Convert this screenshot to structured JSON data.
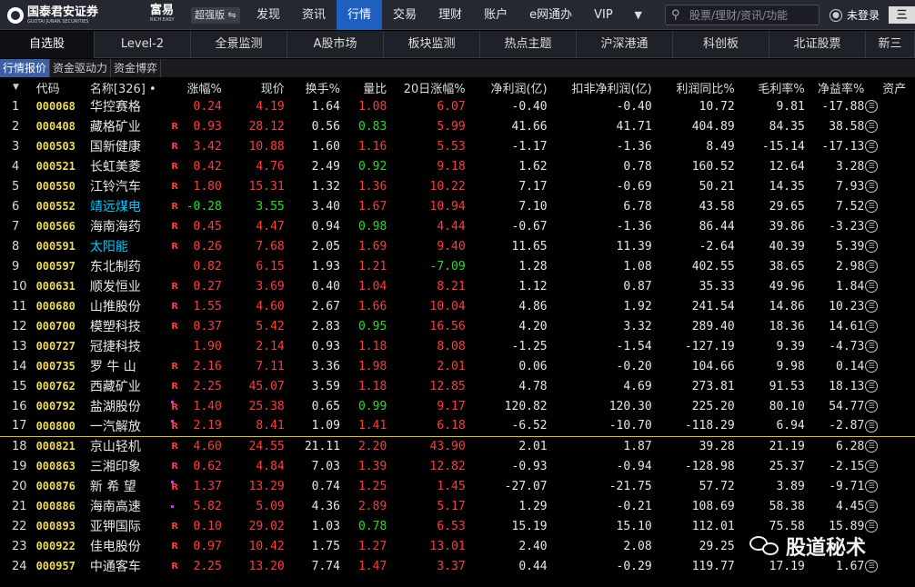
{
  "app": {
    "brand_name": "国泰君安证券",
    "brand_sub": "GUOTAI JUNAN SECURITIES",
    "product_name": "富易",
    "product_sub": "RICH EASY",
    "edition": "超强版 ⇋"
  },
  "topnav": [
    "发现",
    "资讯",
    "行情",
    "交易",
    "理财",
    "账户",
    "e网通办",
    "VIP"
  ],
  "topnav_active": 2,
  "search": {
    "placeholder": "股票/理财/资讯/功能"
  },
  "login_label": "未登录",
  "menu_label": "三",
  "tabs": [
    "自选股",
    "Level-2",
    "全景监测",
    "A股市场",
    "板块监测",
    "热点主题",
    "沪深港通",
    "科创板",
    "北证股票",
    "新三"
  ],
  "tabs_active": 0,
  "subtabs": [
    "行情报价",
    "资金驱动力",
    "资金博弈"
  ],
  "subtabs_active": 0,
  "columns": {
    "sort_icon": "▼",
    "code": "代码",
    "name": "名称[326]",
    "name_dot": "•",
    "chg": "涨幅%",
    "price": "现价",
    "turnover": "换手%",
    "vol_ratio": "量比",
    "chg20": "20日涨幅%",
    "net_profit": "净利润(亿)",
    "deducted_profit": "扣非净利润(亿)",
    "profit_yoy": "利润同比%",
    "gross_margin": "毛利率%",
    "roe": "净益率%",
    "assets": "资产"
  },
  "rows": [
    {
      "idx": "1",
      "code": "000068",
      "name": "华控赛格",
      "mark": "",
      "dot": false,
      "chg": "0.24",
      "price": "4.19",
      "turnover": "1.64",
      "vol_ratio": "1.08",
      "vol_ratio_color": "up",
      "chg20": "6.07",
      "chg20_color": "up",
      "net_profit": "-0.40",
      "deducted_profit": "-0.40",
      "profit_yoy": "10.72",
      "gross_margin": "9.81",
      "roe": "-17.88"
    },
    {
      "idx": "2",
      "code": "000408",
      "name": "藏格矿业",
      "mark": "R",
      "dot": false,
      "chg": "0.93",
      "price": "28.12",
      "turnover": "0.56",
      "vol_ratio": "0.83",
      "vol_ratio_color": "dn",
      "chg20": "5.99",
      "chg20_color": "up",
      "net_profit": "41.66",
      "deducted_profit": "41.71",
      "profit_yoy": "404.89",
      "gross_margin": "84.35",
      "roe": "38.58"
    },
    {
      "idx": "3",
      "code": "000503",
      "name": "国新健康",
      "mark": "R",
      "dot": false,
      "chg": "3.42",
      "price": "10.88",
      "turnover": "1.60",
      "vol_ratio": "1.16",
      "vol_ratio_color": "up",
      "chg20": "5.53",
      "chg20_color": "up",
      "net_profit": "-1.17",
      "deducted_profit": "-1.36",
      "profit_yoy": "8.49",
      "gross_margin": "-15.14",
      "roe": "-17.13"
    },
    {
      "idx": "4",
      "code": "000521",
      "name": "长虹美菱",
      "mark": "R",
      "dot": false,
      "chg": "0.42",
      "price": "4.76",
      "turnover": "2.49",
      "vol_ratio": "0.92",
      "vol_ratio_color": "dn",
      "chg20": "9.18",
      "chg20_color": "up",
      "net_profit": "1.62",
      "deducted_profit": "0.78",
      "profit_yoy": "160.52",
      "gross_margin": "12.64",
      "roe": "3.28"
    },
    {
      "idx": "5",
      "code": "000550",
      "name": "江铃汽车",
      "mark": "R",
      "dot": false,
      "chg": "1.80",
      "price": "15.31",
      "turnover": "1.32",
      "vol_ratio": "1.36",
      "vol_ratio_color": "up",
      "chg20": "10.22",
      "chg20_color": "up",
      "net_profit": "7.17",
      "deducted_profit": "-0.69",
      "profit_yoy": "50.21",
      "gross_margin": "14.35",
      "roe": "7.93"
    },
    {
      "idx": "6",
      "code": "000552",
      "name": "靖远煤电",
      "mark": "R",
      "dot": false,
      "name_hl": true,
      "chg": "-0.28",
      "chg_color": "dn",
      "price": "3.55",
      "price_color": "dn",
      "turnover": "3.40",
      "vol_ratio": "1.67",
      "vol_ratio_color": "up",
      "chg20": "10.94",
      "chg20_color": "up",
      "net_profit": "7.10",
      "deducted_profit": "6.78",
      "profit_yoy": "43.58",
      "gross_margin": "29.65",
      "roe": "7.52"
    },
    {
      "idx": "7",
      "code": "000566",
      "name": "海南海药",
      "mark": "R",
      "dot": false,
      "chg": "0.45",
      "price": "4.47",
      "turnover": "0.94",
      "vol_ratio": "0.98",
      "vol_ratio_color": "dn",
      "chg20": "4.44",
      "chg20_color": "up",
      "net_profit": "-0.67",
      "deducted_profit": "-1.36",
      "profit_yoy": "86.44",
      "gross_margin": "39.86",
      "roe": "-3.23"
    },
    {
      "idx": "8",
      "code": "000591",
      "name": "太阳能",
      "mark": "R",
      "dot": false,
      "name_hl": true,
      "chg": "0.26",
      "price": "7.68",
      "turnover": "2.05",
      "vol_ratio": "1.69",
      "vol_ratio_color": "up",
      "chg20": "9.40",
      "chg20_color": "up",
      "net_profit": "11.65",
      "deducted_profit": "11.39",
      "profit_yoy": "-2.64",
      "gross_margin": "40.39",
      "roe": "5.39"
    },
    {
      "idx": "9",
      "code": "000597",
      "name": "东北制药",
      "mark": "",
      "dot": false,
      "chg": "0.82",
      "price": "6.15",
      "turnover": "1.93",
      "vol_ratio": "1.21",
      "vol_ratio_color": "up",
      "chg20": "-7.09",
      "chg20_color": "dn",
      "net_profit": "1.28",
      "deducted_profit": "1.08",
      "profit_yoy": "402.55",
      "gross_margin": "38.65",
      "roe": "2.98"
    },
    {
      "idx": "10",
      "code": "000631",
      "name": "顺发恒业",
      "mark": "R",
      "dot": false,
      "chg": "0.27",
      "price": "3.69",
      "turnover": "0.40",
      "vol_ratio": "1.04",
      "vol_ratio_color": "up",
      "chg20": "8.21",
      "chg20_color": "up",
      "net_profit": "1.12",
      "deducted_profit": "0.87",
      "profit_yoy": "35.33",
      "gross_margin": "49.96",
      "roe": "1.84"
    },
    {
      "idx": "11",
      "code": "000680",
      "name": "山推股份",
      "mark": "R",
      "dot": false,
      "chg": "1.55",
      "price": "4.60",
      "turnover": "2.67",
      "vol_ratio": "1.66",
      "vol_ratio_color": "up",
      "chg20": "10.04",
      "chg20_color": "up",
      "net_profit": "4.86",
      "deducted_profit": "1.92",
      "profit_yoy": "241.54",
      "gross_margin": "14.86",
      "roe": "10.23"
    },
    {
      "idx": "12",
      "code": "000700",
      "name": "模塑科技",
      "mark": "R",
      "dot": false,
      "chg": "0.37",
      "price": "5.42",
      "turnover": "2.83",
      "vol_ratio": "0.95",
      "vol_ratio_color": "dn",
      "chg20": "16.56",
      "chg20_color": "up",
      "net_profit": "4.20",
      "deducted_profit": "3.32",
      "profit_yoy": "289.40",
      "gross_margin": "18.36",
      "roe": "14.61"
    },
    {
      "idx": "13",
      "code": "000727",
      "name": "冠捷科技",
      "mark": "",
      "dot": false,
      "chg": "1.90",
      "price": "2.14",
      "turnover": "0.93",
      "vol_ratio": "1.18",
      "vol_ratio_color": "up",
      "chg20": "8.08",
      "chg20_color": "up",
      "net_profit": "-1.25",
      "deducted_profit": "-1.54",
      "profit_yoy": "-127.19",
      "gross_margin": "9.39",
      "roe": "-4.73"
    },
    {
      "idx": "14",
      "code": "000735",
      "name": "罗 牛 山",
      "mark": "R",
      "dot": false,
      "chg": "2.16",
      "price": "7.11",
      "turnover": "3.36",
      "vol_ratio": "1.98",
      "vol_ratio_color": "up",
      "chg20": "2.01",
      "chg20_color": "up",
      "net_profit": "0.06",
      "deducted_profit": "-0.20",
      "profit_yoy": "104.66",
      "gross_margin": "9.98",
      "roe": "0.14"
    },
    {
      "idx": "15",
      "code": "000762",
      "name": "西藏矿业",
      "mark": "R",
      "dot": false,
      "chg": "2.25",
      "price": "45.07",
      "turnover": "3.59",
      "vol_ratio": "1.18",
      "vol_ratio_color": "up",
      "chg20": "12.85",
      "chg20_color": "up",
      "net_profit": "4.78",
      "deducted_profit": "4.69",
      "profit_yoy": "273.81",
      "gross_margin": "91.53",
      "roe": "18.13"
    },
    {
      "idx": "16",
      "code": "000792",
      "name": "盐湖股份",
      "mark": "R",
      "dot": true,
      "chg": "1.40",
      "price": "25.38",
      "turnover": "0.65",
      "vol_ratio": "0.99",
      "vol_ratio_color": "dn",
      "chg20": "9.17",
      "chg20_color": "up",
      "net_profit": "120.82",
      "deducted_profit": "120.30",
      "profit_yoy": "225.20",
      "gross_margin": "80.10",
      "roe": "54.77"
    },
    {
      "idx": "17",
      "code": "000800",
      "name": "一汽解放",
      "mark": "R",
      "dot": true,
      "chg": "2.19",
      "price": "8.41",
      "turnover": "1.09",
      "vol_ratio": "1.41",
      "vol_ratio_color": "up",
      "chg20": "6.18",
      "chg20_color": "up",
      "net_profit": "-6.52",
      "deducted_profit": "-10.70",
      "profit_yoy": "-118.29",
      "gross_margin": "6.94",
      "roe": "-2.87",
      "separator": true
    },
    {
      "idx": "18",
      "code": "000821",
      "name": "京山轻机",
      "mark": "R",
      "dot": false,
      "chg": "4.60",
      "price": "24.55",
      "turnover": "21.11",
      "vol_ratio": "2.20",
      "vol_ratio_color": "up",
      "chg20": "43.90",
      "chg20_color": "up",
      "net_profit": "2.01",
      "deducted_profit": "1.87",
      "profit_yoy": "39.28",
      "gross_margin": "21.19",
      "roe": "6.28"
    },
    {
      "idx": "19",
      "code": "000863",
      "name": "三湘印象",
      "mark": "R",
      "dot": false,
      "chg": "0.62",
      "price": "4.84",
      "turnover": "7.03",
      "vol_ratio": "1.39",
      "vol_ratio_color": "up",
      "chg20": "12.82",
      "chg20_color": "up",
      "net_profit": "-0.93",
      "deducted_profit": "-0.94",
      "profit_yoy": "-128.98",
      "gross_margin": "25.37",
      "roe": "-2.15"
    },
    {
      "idx": "20",
      "code": "000876",
      "name": "新 希 望",
      "mark": "R",
      "dot": true,
      "chg": "1.37",
      "price": "13.29",
      "turnover": "0.74",
      "vol_ratio": "1.25",
      "vol_ratio_color": "up",
      "chg20": "1.45",
      "chg20_color": "up",
      "net_profit": "-27.07",
      "deducted_profit": "-21.75",
      "profit_yoy": "57.72",
      "gross_margin": "3.89",
      "roe": "-9.71"
    },
    {
      "idx": "21",
      "code": "000886",
      "name": "海南高速",
      "mark": "",
      "dot": true,
      "chg": "5.82",
      "price": "5.09",
      "turnover": "4.36",
      "vol_ratio": "2.89",
      "vol_ratio_color": "up",
      "chg20": "5.17",
      "chg20_color": "up",
      "net_profit": "1.29",
      "deducted_profit": "-0.21",
      "profit_yoy": "108.69",
      "gross_margin": "58.38",
      "roe": "4.45"
    },
    {
      "idx": "22",
      "code": "000893",
      "name": "亚钾国际",
      "mark": "R",
      "dot": false,
      "chg": "0.10",
      "price": "29.02",
      "turnover": "1.03",
      "vol_ratio": "0.78",
      "vol_ratio_color": "dn",
      "chg20": "6.53",
      "chg20_color": "up",
      "net_profit": "15.19",
      "deducted_profit": "15.10",
      "profit_yoy": "112.01",
      "gross_margin": "75.58",
      "roe": "15.89"
    },
    {
      "idx": "23",
      "code": "000922",
      "name": "佳电股份",
      "mark": "R",
      "dot": false,
      "chg": "0.97",
      "price": "10.42",
      "turnover": "1.75",
      "vol_ratio": "1.27",
      "vol_ratio_color": "up",
      "chg20": "13.01",
      "chg20_color": "up",
      "net_profit": "2.40",
      "deducted_profit": "2.08",
      "profit_yoy": "29.25",
      "gross_margin": "",
      "roe": ""
    },
    {
      "idx": "24",
      "code": "000957",
      "name": "中通客车",
      "mark": "R",
      "dot": false,
      "chg": "2.25",
      "price": "13.20",
      "turnover": "7.74",
      "vol_ratio": "1.47",
      "vol_ratio_color": "up",
      "chg20": "3.37",
      "chg20_color": "up",
      "net_profit": "0.44",
      "deducted_profit": "-0.29",
      "profit_yoy": "119.77",
      "gross_margin": "17.19",
      "roe": "1.67"
    }
  ],
  "watermark": "股道秘术",
  "colors": {
    "up": "#ff3c3c",
    "down": "#20e020",
    "code": "#f0dc5a",
    "accent": "#1f5fbf"
  }
}
